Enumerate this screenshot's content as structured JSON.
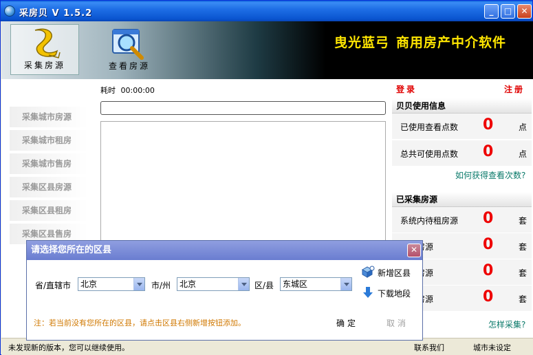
{
  "window": {
    "title": "采房贝 V 1.5.2",
    "minimize_glyph": "_",
    "maximize_glyph": "□",
    "close_glyph": "✕"
  },
  "toolbar": {
    "collect_label": "采集房源",
    "view_label": "查看房源",
    "banner_brand": "曳光蓝弓",
    "banner_slogan": "商用房产中介软件"
  },
  "sidebar": {
    "items": [
      {
        "label": "采集城市房源"
      },
      {
        "label": "采集城市租房"
      },
      {
        "label": "采集城市售房"
      },
      {
        "label": "采集区县房源"
      },
      {
        "label": "采集区县租房"
      },
      {
        "label": "采集区县售房"
      }
    ]
  },
  "main": {
    "elapsed_label": "耗时",
    "elapsed_value": "00:00:00"
  },
  "right_panel": {
    "login_label": "登录",
    "register_label": "注册",
    "usage_header": "贝贝使用信息",
    "used_label": "已使用查看点数",
    "used_value": "0",
    "used_unit": "点",
    "total_label": "总共可使用点数",
    "total_value": "0",
    "total_unit": "点",
    "how_to_get_link": "如何获得查看次数?",
    "collected_header": "已采集房源",
    "collected": [
      {
        "label": "系统内待租房源",
        "value": "0",
        "unit": "套"
      },
      {
        "label": "待售房源",
        "value": "0",
        "unit": "套"
      },
      {
        "label": "待租房源",
        "value": "0",
        "unit": "套"
      },
      {
        "label": "待售房源",
        "value": "0",
        "unit": "套"
      }
    ],
    "how_to_collect_link": "怎样采集?"
  },
  "statusbar": {
    "message": "未发现新的版本，您可以继续使用。",
    "contact_link": "联系我们",
    "city_status": "城市未设定"
  },
  "dialog": {
    "title": "请选择您所在的区县",
    "close_glyph": "✕",
    "province_label": "省/直辖市",
    "province_value": "北京",
    "city_label": "市/州",
    "city_value": "北京",
    "district_label": "区/县",
    "district_value": "东城区",
    "add_district_label": "新增区县",
    "download_label": "下载地段",
    "note": "注：若当前没有您所在的区县，请点击区县右侧新增按钮添加。",
    "ok_label": "确定",
    "cancel_label": "取消"
  },
  "colors": {
    "accent_red": "#ee0000",
    "banner_yellow": "#ffe600",
    "link_teal": "#0a7a6a",
    "note_orange": "#d07800"
  }
}
